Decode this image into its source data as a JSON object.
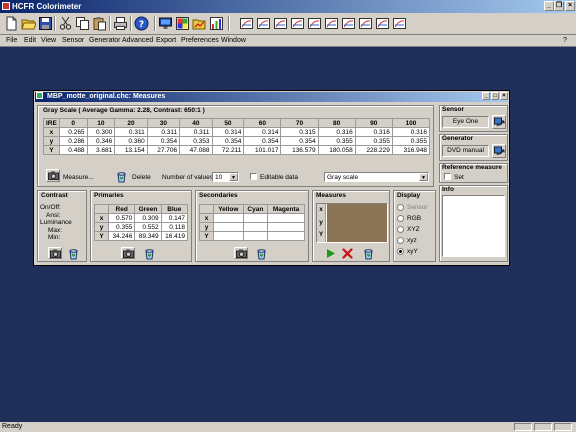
{
  "app": {
    "title": "HCFR Colorimeter",
    "status": "Ready",
    "toolbar_buttons": [
      "new-icon",
      "open-icon",
      "save-icon",
      "cut-icon",
      "copy-icon",
      "paste-icon",
      "print-icon",
      "help-icon",
      "display-icon",
      "palette-icon",
      "folder-chart-icon",
      "chart-icon",
      "view1-icon",
      "view2-icon",
      "view3-icon",
      "view4-icon",
      "view5-icon",
      "view6-icon",
      "view7-icon",
      "view8-icon",
      "view9-icon",
      "view10-icon"
    ],
    "menu": [
      "File",
      "Edit",
      "View",
      "Sensor",
      "Generator",
      "Advanced",
      "Export",
      "Preferences",
      "Window"
    ],
    "menu_right": "?"
  },
  "window": {
    "title": "MBP_motte_original.chc: Measures",
    "header": "Gray Scale ( Average Gamma: 2.28, Contrast: 650:1 )",
    "grayscale": {
      "columns": [
        "IRE",
        "0",
        "10",
        "20",
        "30",
        "40",
        "50",
        "60",
        "70",
        "80",
        "90",
        "100"
      ],
      "rows": [
        {
          "label": "x",
          "values": [
            "0.265",
            "0.300",
            "0.311",
            "0.311",
            "0.311",
            "0.314",
            "0.314",
            "0.315",
            "0.316",
            "0.316",
            "0.316"
          ]
        },
        {
          "label": "y",
          "values": [
            "0.286",
            "0.346",
            "0.360",
            "0.354",
            "0.353",
            "0.354",
            "0.354",
            "0.354",
            "0.355",
            "0.355",
            "0.355"
          ]
        },
        {
          "label": "Y",
          "values": [
            "0.488",
            "3.681",
            "13.154",
            "27.706",
            "47.088",
            "72.211",
            "101.017",
            "136.579",
            "180.058",
            "228.229",
            "316.948"
          ]
        }
      ]
    },
    "controls": {
      "measure": "Measure...",
      "delete": "Delete",
      "number_of_values_label": "Number of values",
      "number_of_values": "10",
      "editable_label": "Editable data",
      "mode": "Gray scale"
    },
    "contrast": {
      "header": "Contrast",
      "lines": [
        "On/Off:",
        "Ansi:",
        "Luminance",
        "Max:",
        "Min:"
      ]
    },
    "primaries": {
      "header": "Primaries",
      "columns": [
        "",
        "Red",
        "Green",
        "Blue"
      ],
      "rows": [
        {
          "label": "x",
          "values": [
            "0.570",
            "0.309",
            "0.147"
          ]
        },
        {
          "label": "y",
          "values": [
            "0.355",
            "0.552",
            "0.118"
          ]
        },
        {
          "label": "Y",
          "values": [
            "34.246",
            "89.349",
            "16.419"
          ]
        }
      ]
    },
    "secondaries": {
      "header": "Secondaries",
      "columns": [
        "",
        "Yellow",
        "Cyan",
        "Magenta"
      ],
      "rows": [
        {
          "label": "x",
          "values": [
            "",
            "",
            ""
          ]
        },
        {
          "label": "y",
          "values": [
            "",
            "",
            ""
          ]
        },
        {
          "label": "Y",
          "values": [
            "",
            "",
            ""
          ]
        }
      ]
    },
    "measures": {
      "header": "Measures",
      "rows": [
        "x",
        "y",
        "Y"
      ],
      "swatch_color": "#8b7355"
    },
    "display": {
      "header": "Display",
      "options": [
        "Sensor",
        "RGB",
        "XYZ",
        "xyz",
        "xyY"
      ],
      "selected": "xyY"
    },
    "sensor": {
      "header": "Sensor",
      "value": "Eye One"
    },
    "generator": {
      "header": "Generator",
      "value": "DVD manual"
    },
    "reference": {
      "header": "Reference measure",
      "set_label": "Set"
    },
    "info": {
      "header": "Info"
    }
  },
  "colors": {
    "mdi_background": "#1f2f5a",
    "titlebar_start": "#0a246a",
    "titlebar_end": "#a6caf0",
    "play": "#1a9a1a",
    "stop": "#cc1111"
  }
}
